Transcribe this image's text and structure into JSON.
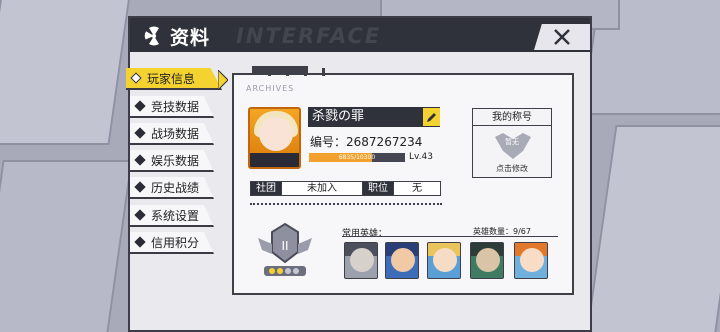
{
  "header": {
    "title": "资料",
    "watermark": "INTERFACE"
  },
  "sidebar": {
    "items": [
      {
        "label": "玩家信息",
        "active": true
      },
      {
        "label": "竞技数据"
      },
      {
        "label": "战场数据"
      },
      {
        "label": "娱乐数据"
      },
      {
        "label": "历史战绩"
      },
      {
        "label": "系统设置"
      },
      {
        "label": "信用积分"
      }
    ]
  },
  "profile": {
    "section_label": "ARCHIVES",
    "name": "杀戮の罪",
    "id_label": "编号：",
    "id_value": "2687267234",
    "exp_text": "6835/10300",
    "exp_fraction": 0.66,
    "level": "Lv.43"
  },
  "title_card": {
    "heading": "我的称号",
    "badge": "暂无",
    "action": "点击修改"
  },
  "guild": {
    "guild_label": "社团",
    "guild_value": "未加入",
    "post_label": "职位",
    "post_value": "无"
  },
  "heroes": {
    "label": "常用英雄：",
    "count_text": "英雄数量：9/67"
  },
  "colors": {
    "accent": "#f4d22f",
    "dark": "#2f313b",
    "exp": "#f2a12e"
  }
}
